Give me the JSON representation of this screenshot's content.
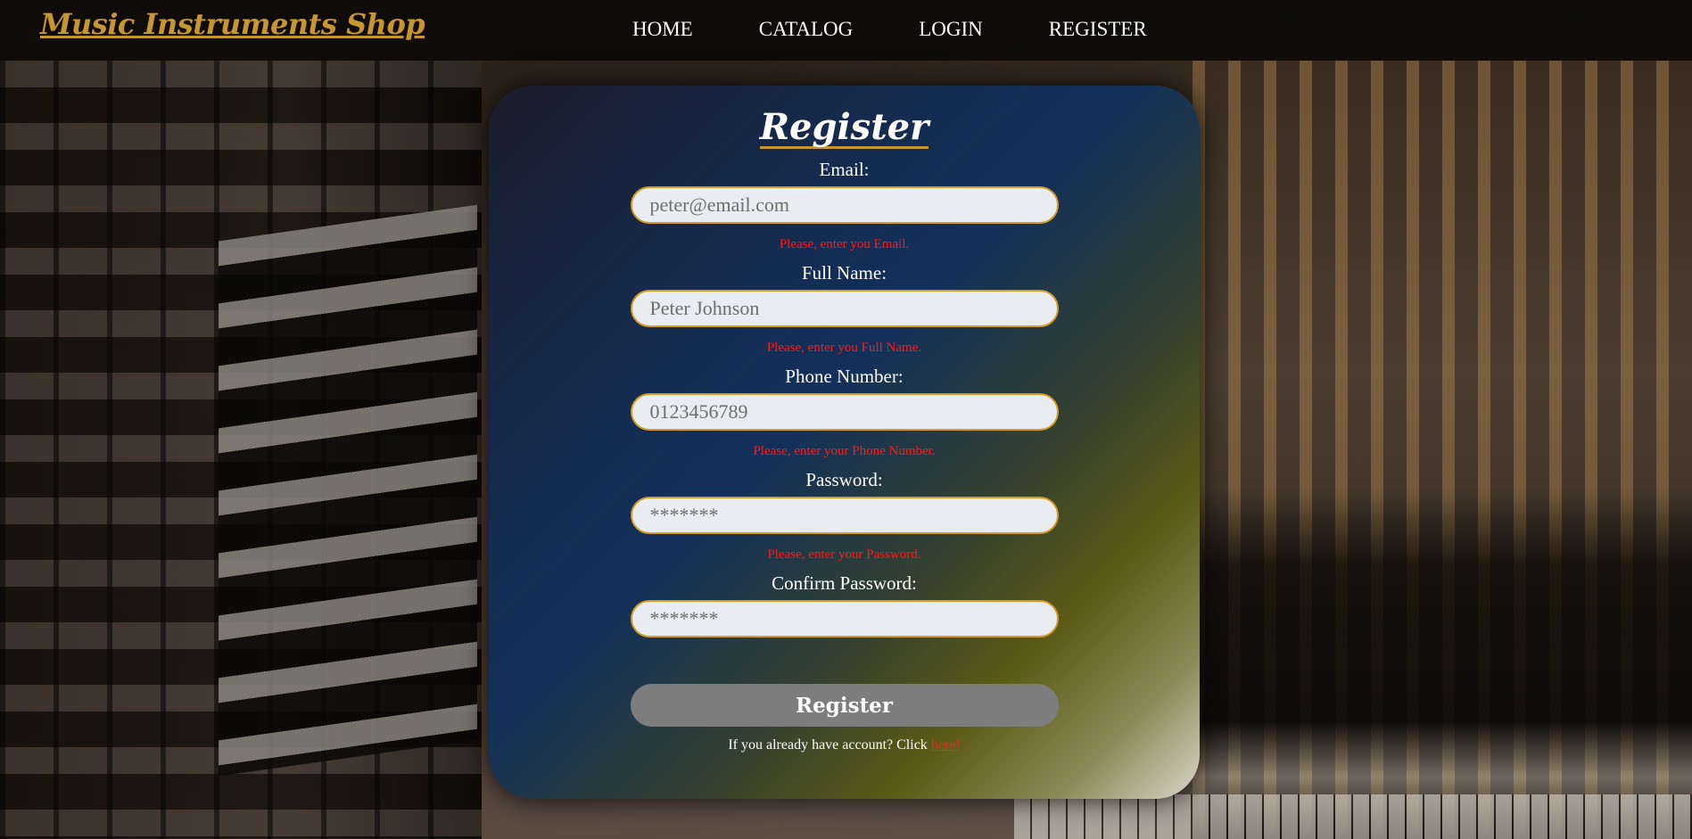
{
  "header": {
    "logo": "Music Instruments Shop",
    "nav": [
      "HOME",
      "CATALOG",
      "LOGIN",
      "REGISTER"
    ]
  },
  "form": {
    "title": "Register",
    "fields": [
      {
        "label": "Email:",
        "placeholder": "peter@email.com",
        "error": "Please, enter you Email."
      },
      {
        "label": "Full Name:",
        "placeholder": "Peter Johnson",
        "error": "Please, enter you Full Name."
      },
      {
        "label": "Phone Number:",
        "placeholder": "0123456789",
        "error": "Please, enter your Phone Number."
      },
      {
        "label": "Password:",
        "placeholder": "*******",
        "error": "Please, enter your Password."
      },
      {
        "label": "Confirm Password:",
        "placeholder": "*******"
      }
    ],
    "submit_label": "Register",
    "login_hint_prefix": "If you already have account? Click ",
    "login_hint_link": "here!"
  },
  "colors": {
    "accent": "#c8962e",
    "error": "#ff1a1a",
    "input_border": "#d49a22",
    "button": "#7d7d7d"
  }
}
